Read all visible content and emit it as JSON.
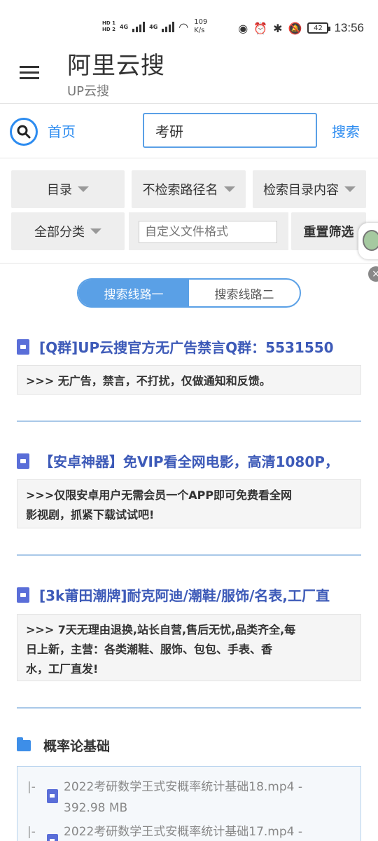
{
  "status_bar": {
    "hd1": "HD 1",
    "hd2": "HD 2",
    "net1": "4G",
    "net2": "4G",
    "speed_value": "109",
    "speed_unit": "K/s",
    "battery": "42",
    "time": "13:56"
  },
  "header": {
    "title": "阿里云搜",
    "subtitle": "UP云搜"
  },
  "search": {
    "home_label": "首页",
    "query": "考研",
    "button_label": "搜索"
  },
  "filters": {
    "directory": "目录",
    "path_mode": "不检索路径名",
    "content_mode": "检索目录内容",
    "category": "全部分类",
    "format_placeholder": "自定义文件格式",
    "reset_label": "重置筛选"
  },
  "routes": {
    "route1": "搜索线路一",
    "route2": "搜索线路二"
  },
  "results": [
    {
      "title": "[Q群]UP云搜官方无广告禁言Q群：5531550",
      "description": ">>> 无广告，禁言，不打扰，仅做通知和反馈。"
    },
    {
      "title": "【安卓神器】免VIP看全网电影，高清1080P，",
      "description_line1": ">>>仅限安卓用户无需会员一个APP即可免费看全网",
      "description_line2": "影视剧，抓紧下载试试吧!"
    },
    {
      "title": "[3k莆田潮牌]耐克阿迪/潮鞋/服饰/名表,工厂直",
      "description_line1": ">>> 7天无理由退换,站长自营,售后无忧,品类齐全,每",
      "description_line2": "日上新，主营：各类潮鞋、服饰、包包、手表、香",
      "description_line3": "水，工厂直发!"
    }
  ],
  "folder": {
    "name": "概率论基础",
    "files": [
      {
        "prefix": "|-",
        "name_line1": "2022考研数学王式安概率统计基础18.mp4  -",
        "name_line2": "392.98 MB"
      },
      {
        "prefix": "|-",
        "name_line1": "2022考研数学王式安概率统计基础17.mp4  -"
      }
    ]
  },
  "colors": {
    "accent": "#2d8cf0",
    "route_active": "#5aa0e6",
    "result_title": "#3d5ab8",
    "divider": "#a9c8e8"
  }
}
